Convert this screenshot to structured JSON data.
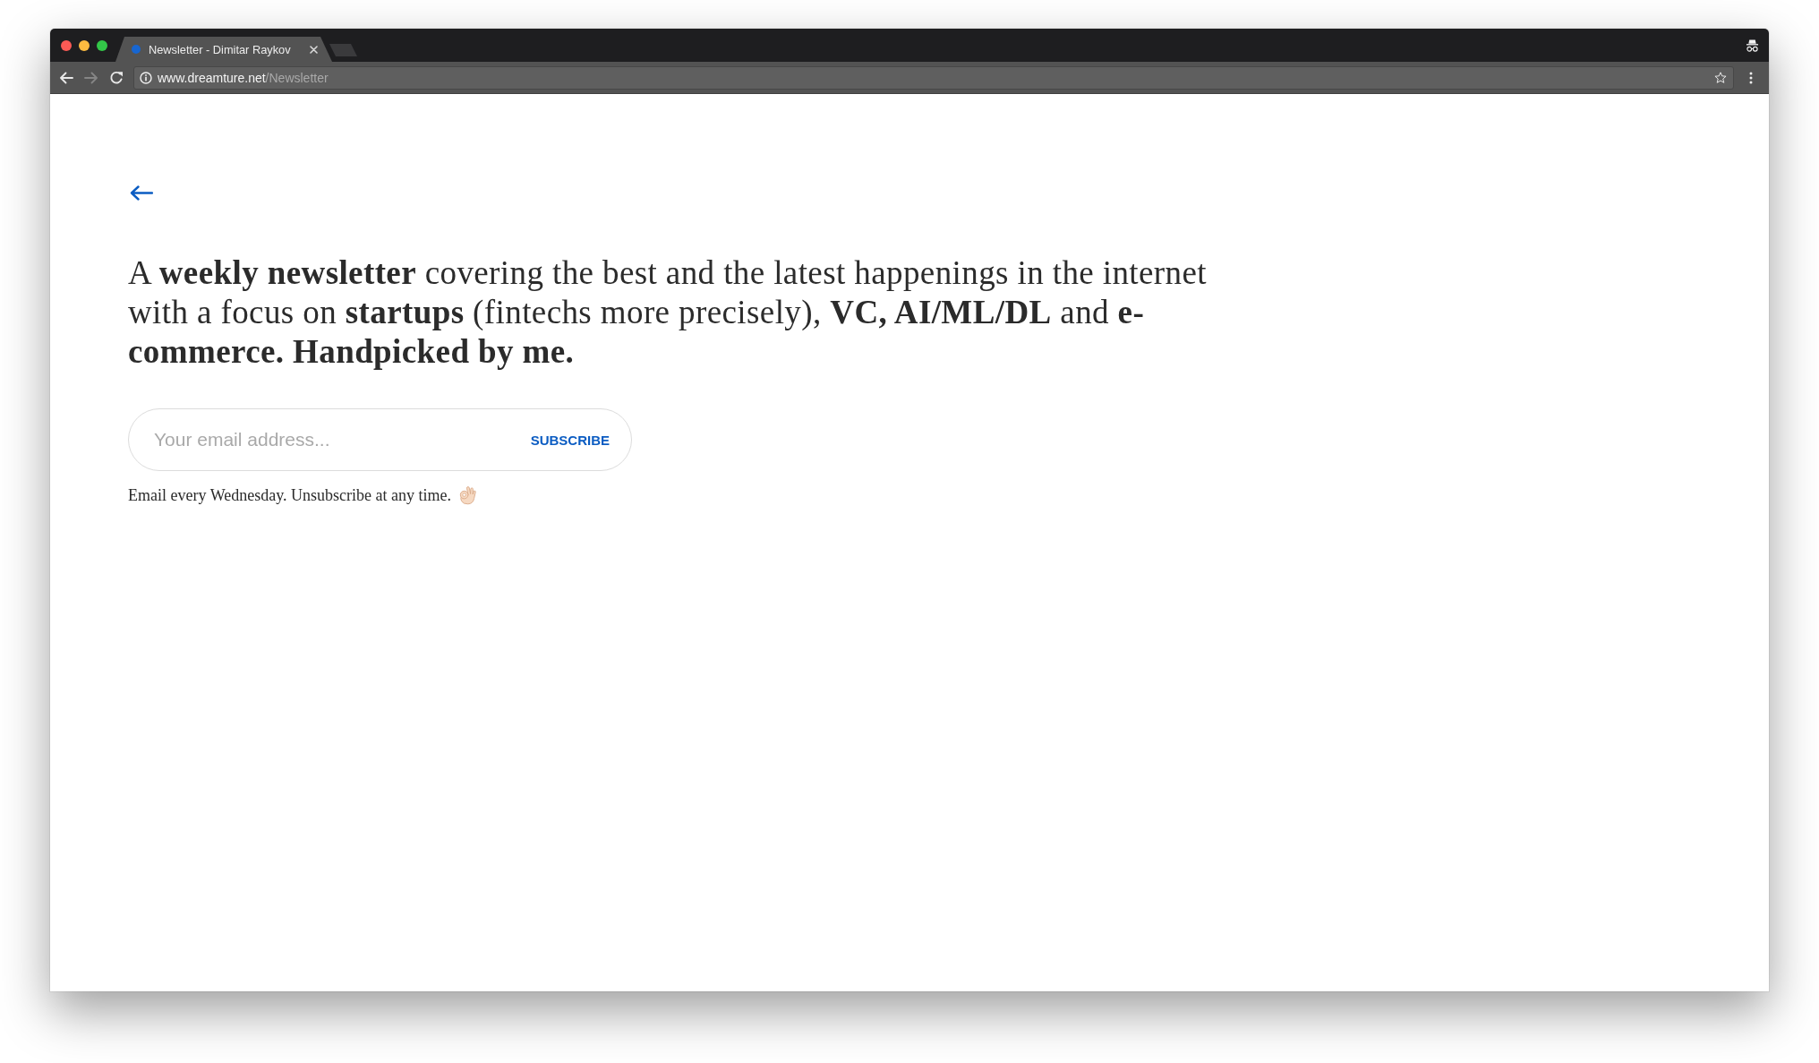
{
  "window": {
    "tabs": [
      {
        "title": "Newsletter - Dimitar Raykov",
        "selected": true
      }
    ],
    "toolbar": {
      "buttons": [
        {
          "kind": "back",
          "disabled": false
        },
        {
          "kind": "forward",
          "disabled": true
        },
        {
          "kind": "reload",
          "disabled": false
        }
      ],
      "address_bar": {
        "host": "www.dreamture.net",
        "path": "/Newsletter"
      }
    }
  },
  "page": {
    "intro": "A **weekly newsletter** covering the best and the latest happenings in the internet with a focus on **startups** (fintechs more precisely), **VC, AI/ML/DL** and **e-commerce. Handpicked by me.**",
    "email_field": {
      "placeholder": "Your email address..."
    },
    "subscribe_button": "SUBSCRIBE",
    "note": "Email every Wednesday. Unsubscribe at any time."
  }
}
